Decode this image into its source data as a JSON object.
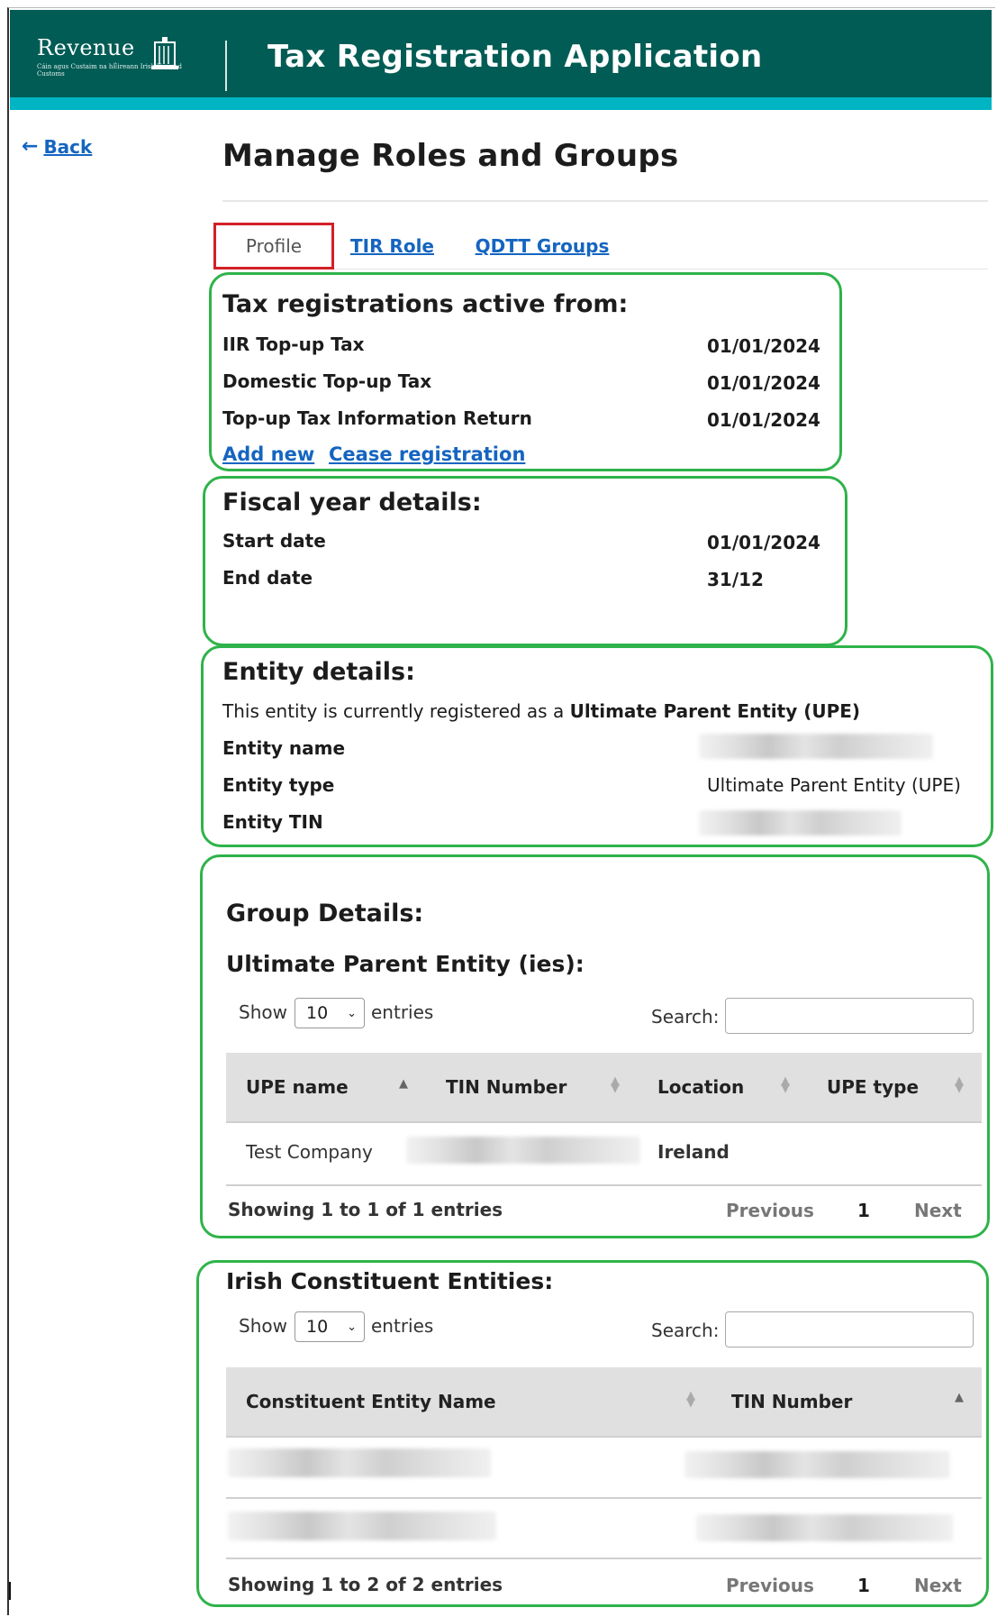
{
  "header": {
    "logo_word": "Revenue",
    "logo_sub": "Cáin agus Custaim na hÉireann Irish Tax and Customs",
    "title": "Tax Registration Application",
    "colors": {
      "header_bg": "#005c55",
      "band": "#00b5c3",
      "highlight_green": "#2fb34a",
      "highlight_red": "#d32027",
      "link": "#1565c0"
    }
  },
  "nav": {
    "back_label": "Back",
    "back_icon": "arrow-left-icon"
  },
  "page": {
    "title": "Manage Roles and Groups"
  },
  "tabs": [
    {
      "label": "Profile",
      "active": true
    },
    {
      "label": "TIR Role",
      "active": false
    },
    {
      "label": "QDTT Groups",
      "active": false
    }
  ],
  "tax_registrations": {
    "title": "Tax registrations active from:",
    "rows": [
      {
        "label": "IIR Top-up Tax",
        "value": "01/01/2024"
      },
      {
        "label": "Domestic Top-up Tax",
        "value": "01/01/2024"
      },
      {
        "label": "Top-up Tax Information Return",
        "value": "01/01/2024"
      }
    ],
    "add_new": "Add new",
    "cease": "Cease registration"
  },
  "fiscal_year": {
    "title": "Fiscal year details:",
    "rows": [
      {
        "label": "Start date",
        "value": "01/01/2024"
      },
      {
        "label": "End date",
        "value": "31/12"
      }
    ]
  },
  "entity": {
    "title": "Entity details:",
    "registered_prefix": "This entity is currently registered as a",
    "registered_as": "Ultimate Parent Entity (UPE)",
    "rows": [
      {
        "label": "Entity name",
        "value": ""
      },
      {
        "label": "Entity type",
        "value": "Ultimate Parent Entity (UPE)"
      },
      {
        "label": "Entity TIN",
        "value": ""
      }
    ]
  },
  "group": {
    "title": "Group Details:",
    "upe_title": "Ultimate Parent Entity (ies):",
    "show_label": "Show",
    "entries_label": "entries",
    "page_size": "10",
    "search_label": "Search:",
    "columns": [
      "UPE name",
      "TIN Number",
      "Location",
      "UPE type"
    ],
    "rows": [
      {
        "name": "Test Company",
        "tin": "",
        "location": "Ireland",
        "type": ""
      }
    ],
    "footer": "Showing 1 to 1 of 1 entries",
    "previous": "Previous",
    "page": "1",
    "next": "Next"
  },
  "irish": {
    "title": "Irish Constituent Entities:",
    "show_label": "Show",
    "entries_label": "entries",
    "page_size": "10",
    "search_label": "Search:",
    "columns": [
      "Constituent Entity Name",
      "TIN Number"
    ],
    "footer": "Showing 1 to 2 of 2 entries",
    "previous": "Previous",
    "page": "1",
    "next": "Next"
  }
}
